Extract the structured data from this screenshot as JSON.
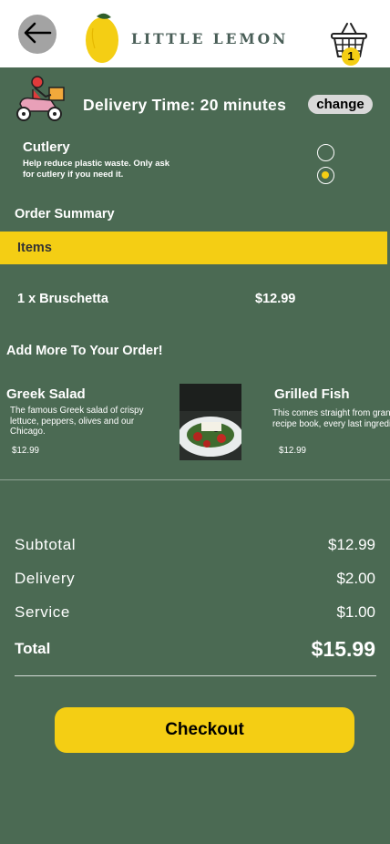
{
  "header": {
    "brand": "LITTLE LEMON",
    "basket_count": "1"
  },
  "delivery": {
    "text": "Delivery Time: 20 minutes",
    "change_label": "change"
  },
  "cutlery": {
    "title": "Cutlery",
    "help": "Help reduce plastic waste. Only ask for cutlery if you need it.",
    "options": [
      {
        "selected": false
      },
      {
        "selected": true
      }
    ]
  },
  "order_summary": {
    "title": "Order Summary",
    "items_label": "Items",
    "lines": [
      {
        "name": "1 x Bruschetta",
        "price": "$12.99"
      }
    ]
  },
  "add_more": {
    "title": "Add More To Your Order!",
    "dishes": [
      {
        "name": "Greek Salad",
        "description": "The famous Greek salad of crispy lettuce, peppers, olives and our Chicago.",
        "price": "$12.99"
      },
      {
        "name": "Grilled Fish",
        "description": "This comes straight from grandma's recipe book, every last ingredient",
        "price": "$12.99"
      }
    ]
  },
  "totals": {
    "subtotal_label": "Subtotal",
    "subtotal_value": "$12.99",
    "delivery_label": "Delivery",
    "delivery_value": "$2.00",
    "service_label": "Service",
    "service_value": "$1.00",
    "total_label": "Total",
    "total_value": "$15.99"
  },
  "checkout_label": "Checkout",
  "colors": {
    "background": "#4b6a53",
    "accent": "#f4ce14",
    "brand_text": "#495e57"
  }
}
